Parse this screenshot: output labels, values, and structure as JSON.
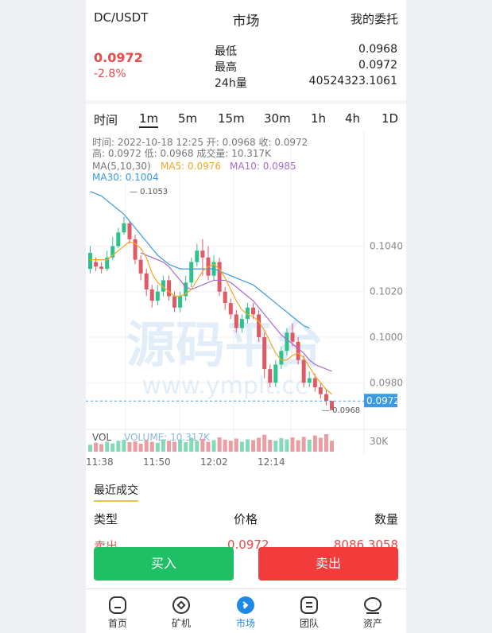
{
  "header": {
    "pair": "DC/USDT",
    "title": "市场",
    "orders_link": "我的委托"
  },
  "ticker": {
    "price": "0.0972",
    "change": "-2.8%",
    "low_label": "最低",
    "low": "0.0968",
    "high_label": "最高",
    "high": "0.0972",
    "volume_label": "24h量",
    "volume": "40524323.1061"
  },
  "timeframes": {
    "label": "时间",
    "items": [
      "1m",
      "5m",
      "15m",
      "30m",
      "1h",
      "4h",
      "1D"
    ],
    "active": "1m"
  },
  "chart_info": {
    "line1": "时间: 2022-10-18 12:25   开: 0.0968   收: 0.0972",
    "line2": "高: 0.0972   低: 0.0968   成交量: 10.317K",
    "ma_title": "MA(5,10,30)",
    "ma5": "MA5: 0.0976",
    "ma10": "MA10: 0.0985",
    "ma30": "MA30: 0.1004",
    "vol_label": "VOL",
    "volume_text": "VOLUME: 10.317K",
    "hi_marker": "0.1053",
    "lo_marker": "0.0968",
    "last_price_tag": "0.0972",
    "vol_axis": "30K",
    "watermark": "源码平台",
    "watermark_url": "www.ymplt.cc"
  },
  "chart_data": {
    "type": "candlestick",
    "y_ticks": [
      "0.1040",
      "0.1020",
      "0.1000",
      "0.0980"
    ],
    "ylim": [
      0.0963,
      0.1066
    ],
    "x_ticks": [
      "11:38",
      "11:50",
      "12:02",
      "12:14"
    ],
    "colors": {
      "up": "#2ec28b",
      "down": "#e05a66",
      "ma5": "#f5a623",
      "ma10": "#a66bd3",
      "ma30": "#3b9ae1"
    },
    "candles": [
      [
        0.103,
        0.1037,
        0.1028,
        0.104
      ],
      [
        0.1033,
        0.1031,
        0.1029,
        0.1035
      ],
      [
        0.1031,
        0.103,
        0.1028,
        0.1033
      ],
      [
        0.103,
        0.1035,
        0.1029,
        0.1038
      ],
      [
        0.1035,
        0.104,
        0.1034,
        0.1044
      ],
      [
        0.104,
        0.1046,
        0.1039,
        0.1048
      ],
      [
        0.1046,
        0.105,
        0.1045,
        0.1053
      ],
      [
        0.105,
        0.1043,
        0.1041,
        0.1051
      ],
      [
        0.1043,
        0.1034,
        0.1032,
        0.1045
      ],
      [
        0.1034,
        0.1028,
        0.1025,
        0.1036
      ],
      [
        0.1028,
        0.1021,
        0.1018,
        0.103
      ],
      [
        0.1021,
        0.1016,
        0.1013,
        0.1023
      ],
      [
        0.1016,
        0.102,
        0.1014,
        0.1023
      ],
      [
        0.102,
        0.1025,
        0.1018,
        0.1027
      ],
      [
        0.1025,
        0.1018,
        0.1016,
        0.1027
      ],
      [
        0.1018,
        0.1013,
        0.1011,
        0.102
      ],
      [
        0.1013,
        0.1018,
        0.1011,
        0.102
      ],
      [
        0.1018,
        0.1024,
        0.1016,
        0.1027
      ],
      [
        0.1024,
        0.1033,
        0.1022,
        0.1035
      ],
      [
        0.1033,
        0.1038,
        0.1031,
        0.1041
      ],
      [
        0.1038,
        0.1035,
        0.1027,
        0.1043
      ],
      [
        0.1035,
        0.1027,
        0.1025,
        0.104
      ],
      [
        0.1027,
        0.1033,
        0.1025,
        0.1036
      ],
      [
        0.1033,
        0.102,
        0.1018,
        0.1035
      ],
      [
        0.102,
        0.1015,
        0.1012,
        0.1022
      ],
      [
        0.1015,
        0.101,
        0.1008,
        0.1017
      ],
      [
        0.101,
        0.1004,
        0.1002,
        0.1012
      ],
      [
        0.1004,
        0.1008,
        0.1002,
        0.101
      ],
      [
        0.1008,
        0.1013,
        0.1006,
        0.1015
      ],
      [
        0.1013,
        0.101,
        0.1008,
        0.1015
      ],
      [
        0.101,
        0.1,
        0.0998,
        0.1012
      ],
      [
        0.1,
        0.0986,
        0.0982,
        0.1002
      ],
      [
        0.0986,
        0.098,
        0.0978,
        0.0988
      ],
      [
        0.098,
        0.0988,
        0.0978,
        0.099
      ],
      [
        0.0988,
        0.0994,
        0.0986,
        0.0996
      ],
      [
        0.0994,
        0.1002,
        0.0992,
        0.1004
      ],
      [
        0.1002,
        0.0998,
        0.0996,
        0.1006
      ],
      [
        0.0998,
        0.099,
        0.0988,
        0.1
      ],
      [
        0.099,
        0.098,
        0.0978,
        0.0992
      ],
      [
        0.098,
        0.0982,
        0.0978,
        0.0985
      ],
      [
        0.0982,
        0.0978,
        0.0976,
        0.0984
      ],
      [
        0.0978,
        0.0975,
        0.0973,
        0.098
      ],
      [
        0.0975,
        0.0972,
        0.097,
        0.0977
      ],
      [
        0.0972,
        0.0968,
        0.0968,
        0.0972
      ]
    ],
    "ma5": [
      0.1034,
      0.1034,
      0.1034,
      0.1034,
      0.1036,
      0.1038,
      0.104,
      0.1042,
      0.1041,
      0.1039,
      0.1035,
      0.1028,
      0.1024,
      0.1022,
      0.102,
      0.1018,
      0.1018,
      0.1019,
      0.1021,
      0.1025,
      0.1029,
      0.1031,
      0.1032,
      0.103,
      0.1026,
      0.1021,
      0.1016,
      0.1012,
      0.101,
      0.1009,
      0.1007,
      0.1003,
      0.0998,
      0.0993,
      0.099,
      0.099,
      0.0992,
      0.0993,
      0.0991,
      0.0987,
      0.0983,
      0.098,
      0.0977,
      0.0975
    ],
    "ma10": [
      null,
      null,
      null,
      null,
      null,
      null,
      null,
      null,
      null,
      0.1037,
      0.1036,
      0.1035,
      0.1034,
      0.1033,
      0.1031,
      0.1028,
      0.1025,
      0.1022,
      0.1021,
      0.1022,
      0.1023,
      0.1024,
      0.1025,
      0.1025,
      0.1025,
      0.1024,
      0.1022,
      0.102,
      0.1018,
      0.1016,
      0.1013,
      0.101,
      0.1007,
      0.1004,
      0.1001,
      0.0999,
      0.0997,
      0.0995,
      0.0993,
      0.099,
      0.0988,
      0.0987,
      0.0986,
      0.0985
    ],
    "ma30": [
      0.1064,
      0.1063,
      0.1062,
      0.106,
      0.1058,
      0.1056,
      0.1054,
      0.1051,
      0.1048,
      0.1045,
      0.1042,
      0.1039,
      0.1036,
      0.1034,
      0.1032,
      0.1031,
      0.103,
      0.103,
      0.103,
      0.103,
      0.103,
      0.103,
      0.103,
      0.1029,
      0.1028,
      0.1027,
      0.1026,
      0.1025,
      0.1024,
      0.1023,
      0.1021,
      0.1019,
      0.1017,
      0.1015,
      0.1013,
      0.1011,
      0.1009,
      0.1007,
      0.1005,
      0.1004
    ],
    "volumes": [
      0.35,
      0.45,
      0.38,
      0.5,
      0.42,
      0.55,
      0.6,
      0.48,
      0.52,
      0.4,
      0.58,
      0.5,
      0.45,
      0.62,
      0.55,
      0.5,
      0.6,
      0.48,
      0.7,
      0.55,
      0.65,
      0.5,
      0.58,
      0.72,
      0.6,
      0.55,
      0.66,
      0.5,
      0.62,
      0.58,
      0.7,
      0.85,
      0.6,
      0.55,
      0.68,
      0.62,
      0.72,
      0.58,
      0.75,
      0.6,
      0.82,
      0.7,
      0.88,
      0.55
    ]
  },
  "recent": {
    "tab": "最近成交",
    "col_type": "类型",
    "col_price": "价格",
    "col_qty": "数量",
    "row": {
      "type": "卖出",
      "price": "0.0972",
      "qty": "8086.3058"
    }
  },
  "actions": {
    "buy": "买入",
    "sell": "卖出"
  },
  "nav": [
    {
      "label": "首页",
      "icon": "home-icon"
    },
    {
      "label": "矿机",
      "icon": "miner-icon"
    },
    {
      "label": "市场",
      "icon": "market-icon",
      "active": true
    },
    {
      "label": "团队",
      "icon": "team-icon"
    },
    {
      "label": "资产",
      "icon": "assets-icon"
    }
  ]
}
